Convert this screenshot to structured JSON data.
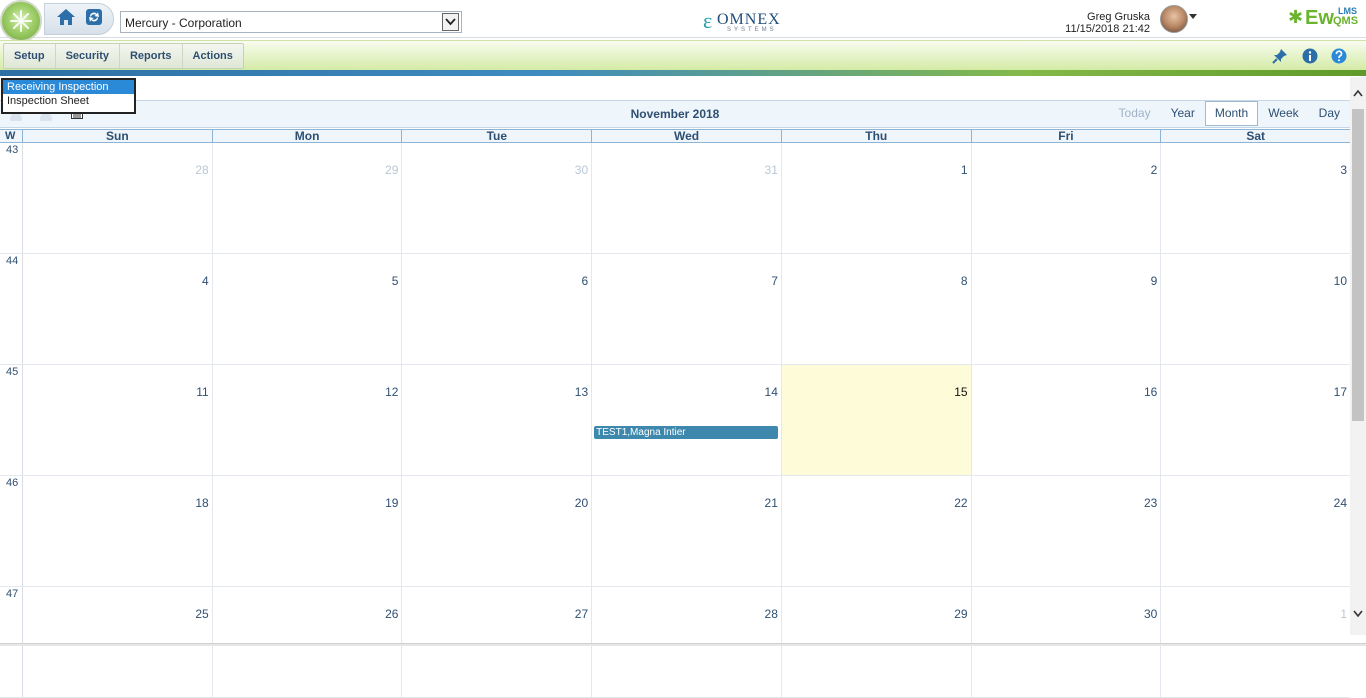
{
  "header": {
    "org_selector": "Mercury - Corporation",
    "omnex_name": "OMNEX",
    "omnex_sub": "SYSTEMS",
    "user_name": "Greg Gruska",
    "user_datetime": "11/15/2018 21:42",
    "ewqms_ew": "Ew",
    "ewqms_lms": "LMS",
    "ewqms_qms": "QMS"
  },
  "menu": {
    "items": [
      {
        "label": "Setup"
      },
      {
        "label": "Security"
      },
      {
        "label": "Reports"
      },
      {
        "label": "Actions"
      }
    ]
  },
  "dropdown": {
    "options": [
      {
        "label": "Receiving Inspection",
        "selected": true
      },
      {
        "label": "Inspection Sheet",
        "selected": false
      }
    ]
  },
  "calendar": {
    "title": "November 2018",
    "views": [
      "Today",
      "Year",
      "Month",
      "Week",
      "Day"
    ],
    "active_view": "Month",
    "week_col_label": "W",
    "days_of_week": [
      "Sun",
      "Mon",
      "Tue",
      "Wed",
      "Thu",
      "Fri",
      "Sat"
    ],
    "weeks": [
      {
        "num": "43",
        "days": [
          {
            "d": "28",
            "other": true
          },
          {
            "d": "29",
            "other": true
          },
          {
            "d": "30",
            "other": true
          },
          {
            "d": "31",
            "other": true
          },
          {
            "d": "1"
          },
          {
            "d": "2"
          },
          {
            "d": "3"
          }
        ]
      },
      {
        "num": "44",
        "days": [
          {
            "d": "4"
          },
          {
            "d": "5"
          },
          {
            "d": "6"
          },
          {
            "d": "7"
          },
          {
            "d": "8"
          },
          {
            "d": "9"
          },
          {
            "d": "10"
          }
        ]
      },
      {
        "num": "45",
        "days": [
          {
            "d": "11"
          },
          {
            "d": "12"
          },
          {
            "d": "13"
          },
          {
            "d": "14",
            "event": "TEST1,Magna Intier"
          },
          {
            "d": "15",
            "today": true
          },
          {
            "d": "16"
          },
          {
            "d": "17"
          }
        ]
      },
      {
        "num": "46",
        "days": [
          {
            "d": "18"
          },
          {
            "d": "19"
          },
          {
            "d": "20"
          },
          {
            "d": "21"
          },
          {
            "d": "22"
          },
          {
            "d": "23"
          },
          {
            "d": "24"
          }
        ]
      },
      {
        "num": "47",
        "days": [
          {
            "d": "25"
          },
          {
            "d": "26"
          },
          {
            "d": "27"
          },
          {
            "d": "28"
          },
          {
            "d": "29"
          },
          {
            "d": "30"
          },
          {
            "d": "1",
            "other": true
          }
        ]
      }
    ]
  },
  "colors": {
    "accent_blue": "#2f4f72",
    "event_bg": "#3f88ad",
    "today_bg": "#fdfbd8",
    "menubar_green": "#d4eba5"
  }
}
